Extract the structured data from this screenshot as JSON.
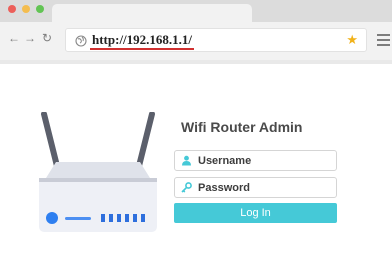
{
  "browser": {
    "url": "http://192.168.1.1/",
    "icons": {
      "back": "arrow-left",
      "forward": "arrow-right",
      "reload": "reload",
      "site": "globe",
      "bookmark": "star",
      "menu": "hamburger-menu"
    },
    "colors": {
      "close": "#ec5f5a",
      "minimize": "#f4bd4f",
      "maximize": "#62c454",
      "bookmark_star": "#f1b21a",
      "url_underline": "#d03030"
    }
  },
  "login": {
    "title": "Wifi Router Admin",
    "username_placeholder": "Username",
    "password_placeholder": "Password",
    "submit_label": "Log In",
    "accent": "#45c9d7"
  },
  "router": {
    "body_color": "#eef0f6",
    "antenna_color": "#5b5f6b",
    "power_led": "#2e7ff0",
    "port_color": "#2e6fdd",
    "port_count": 6
  }
}
